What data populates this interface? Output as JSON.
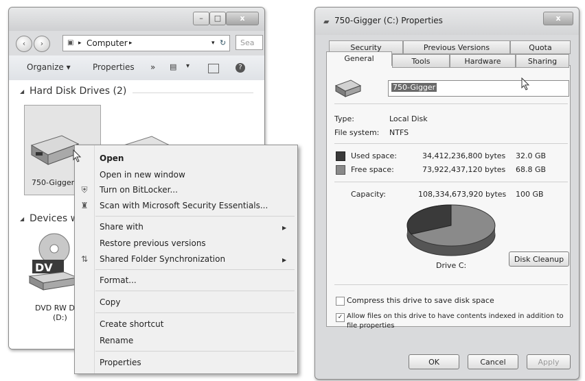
{
  "explorer": {
    "address": {
      "computer_label": "Computer",
      "sep1": "▸",
      "sep2": "▸",
      "refresh": "↻"
    },
    "search": {
      "placeholder": "Sea"
    },
    "toolbar": {
      "organize": "Organize ▾",
      "properties": "Properties",
      "more": "»",
      "views": "▾"
    },
    "hard_disk_group": {
      "label": "Hard Disk Drives (2)"
    },
    "devices_group": {
      "label": "Devices w"
    },
    "drive1_label": "750-Gigger",
    "dvd_label_line1": "DVD RW D",
    "dvd_label_line2": "(D:)",
    "dvd_text": "DV"
  },
  "context_menu": {
    "open": "Open",
    "open_new_window": "Open in new window",
    "turn_on_bitlocker": "Turn on BitLocker...",
    "scan": "Scan with Microsoft Security Essentials...",
    "share_with": "Share with",
    "restore_previous": "Restore previous versions",
    "shared_folder_sync": "Shared Folder Synchronization",
    "format": "Format...",
    "copy": "Copy",
    "create_shortcut": "Create shortcut",
    "rename": "Rename",
    "properties": "Properties"
  },
  "properties_dialog": {
    "title": "750-Gigger (C:) Properties",
    "close_glyph": "x",
    "tabs_back": [
      "Security",
      "Previous Versions",
      "Quota"
    ],
    "tabs_front": [
      "General",
      "Tools",
      "Hardware",
      "Sharing"
    ],
    "name_value": "750-Gigger",
    "type_label": "Type:",
    "type_value": "Local Disk",
    "fs_label": "File system:",
    "fs_value": "NTFS",
    "used_label": "Used space:",
    "used_bytes": "34,412,236,800 bytes",
    "used_gb": "32.0 GB",
    "free_label": "Free space:",
    "free_bytes": "73,922,437,120 bytes",
    "free_gb": "68.8 GB",
    "capacity_label": "Capacity:",
    "capacity_bytes": "108,334,673,920 bytes",
    "capacity_gb": "100 GB",
    "drive_caption": "Drive C:",
    "disk_cleanup": "Disk Cleanup",
    "compress_label": "Compress this drive to save disk space",
    "compress_checked": false,
    "index_label_line1": "Allow files on this drive to have contents indexed in addition to",
    "index_label_line2": "file properties",
    "index_checked": true,
    "ok": "OK",
    "cancel": "Cancel",
    "apply": "Apply",
    "used_fraction": 0.32,
    "colors": {
      "used": "#3a3a3a",
      "free": "#8a8a8a"
    }
  }
}
